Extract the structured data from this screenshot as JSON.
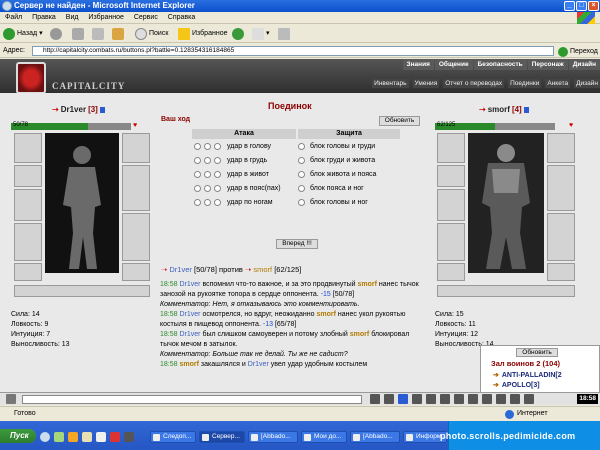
{
  "window": {
    "title": "Сервер не найден - Microsoft Internet Explorer"
  },
  "menu": [
    "Файл",
    "Правка",
    "Вид",
    "Избранное",
    "Сервис",
    "Справка"
  ],
  "toolbar": {
    "back": "Назад",
    "search": "Поиск",
    "favorites": "Избранное"
  },
  "address": {
    "label": "Адрес:",
    "url": "http://capitalcity.combats.ru/buttons.pl?battle=0.128354316184865",
    "go": "Переход"
  },
  "site": {
    "logo": "CAPITALCITY",
    "topnav": [
      "Знания",
      "Общение",
      "Безопасность",
      "Персонаж",
      "Дизайн"
    ],
    "subnav": [
      "Инвентарь",
      "Умения",
      "Отчет о переводах",
      "Поединки",
      "Анкета",
      "Дизайн"
    ]
  },
  "player1": {
    "name": "Dr1ver",
    "level": "[3]",
    "hp": "50/78",
    "hp_fraction": 0.64,
    "stats": [
      "Сила: 14",
      "Ловкость: 9",
      "Интуиция: 7",
      "Выносливость: 13"
    ]
  },
  "player2": {
    "name": "smorf",
    "level": "[4]",
    "hp": "62/125",
    "hp_fraction": 0.5,
    "stats": [
      "Сила: 15",
      "Ловкость: 11",
      "Интуиция: 12",
      "Выносливость: 14"
    ]
  },
  "fight": {
    "title": "Поединок",
    "your_move": "Ваш ход",
    "refresh": "Обновить",
    "attack_header": "Атака",
    "defense_header": "Защита",
    "attacks": [
      "удар в голову",
      "удар в грудь",
      "удар в живот",
      "удар в пояс(пах)",
      "удар по ногам"
    ],
    "defenses": [
      "блок головы и груди",
      "блок груди и живота",
      "блок живота и пояса",
      "блок пояса и ног",
      "блок головы и ног"
    ],
    "forward": "Вперед !!!",
    "vs_p1": "Dr1ver",
    "vs_p1_hp": "[50/78]",
    "vs_word": "против",
    "vs_p2": "smorf",
    "vs_p2_hp": "[62/125]"
  },
  "log": {
    "l1_time": "18:58",
    "l1_a": "Dr1ver",
    "l1_b": "вспомнил что-то важное, и за это продвинутый",
    "l1_c": "smorf",
    "l1_d": "нанес тычок занозой на рукоятке топора в сердце оппонента.",
    "l1_dmg": "-15",
    "l1_hp": "[50/78]",
    "c1": "Комментатор: Нет, я отказываюсь это комментировать.",
    "l2_time": "18:58",
    "l2_a": "Dr1ver",
    "l2_b": "осмотрелся, но вдруг, неожиданно",
    "l2_c": "smorf",
    "l2_d": "нанес укол рукоятью костыля в пищевод оппонента.",
    "l2_dmg": "-13",
    "l2_hp": "[65/78]",
    "l3_time": "18:58",
    "l3_a": "Dr1ver",
    "l3_b": "был слишком самоуверен и потому злобный",
    "l3_c": "smorf",
    "l3_d": "блокировал тычок мечом в затылок.",
    "c2": "Комментатор: Больше так не делай. Ты же не садист?",
    "l4_time": "18:58",
    "l4_a": "smorf",
    "l4_b": "закашлялся и",
    "l4_c": "Dr1ver",
    "l4_d": "увел удар удобным костылем"
  },
  "room": {
    "refresh": "Обновить",
    "title": "Зал воинов 2 (104)",
    "items": [
      "ANTI-PALLADIN[2",
      "APOLLO[3]"
    ]
  },
  "chat": {
    "clock": "18:58"
  },
  "status": {
    "text": "Готово",
    "zone": "Интернет"
  },
  "taskbar": {
    "start": "Пуск",
    "tasks": [
      "Следоп...",
      "Сервер...",
      "[Abbado...",
      "Мои до...",
      "[Abbado...",
      "Информ..."
    ],
    "watermark": "photo.scrolls.pedimicide.com"
  }
}
